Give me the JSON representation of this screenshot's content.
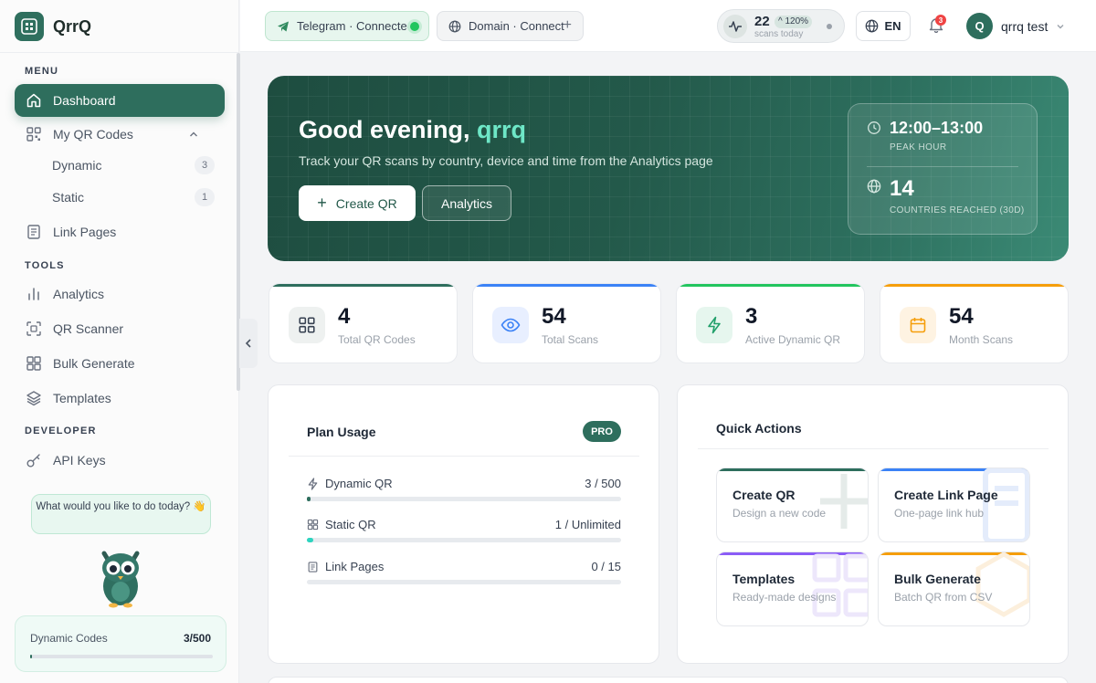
{
  "app": {
    "name": "QrrQ"
  },
  "sidebar": {
    "menu_label": "MENU",
    "tools_label": "TOOLS",
    "developer_label": "DEVELOPER",
    "items": {
      "dashboard": "Dashboard",
      "my_qr_codes": "My QR Codes",
      "dynamic": "Dynamic",
      "dynamic_count": "3",
      "static": "Static",
      "static_count": "1",
      "link_pages": "Link Pages",
      "analytics": "Analytics",
      "qr_scanner": "QR Scanner",
      "bulk_generate": "Bulk Generate",
      "templates": "Templates",
      "api_keys": "API Keys"
    },
    "assistant_prompt": "What would you like to do today? 👋",
    "dynamic_codes": {
      "label": "Dynamic Codes",
      "value": "3/500",
      "fraction": 0.006
    }
  },
  "topbar": {
    "telegram": "Telegram · Connected",
    "domain": "Domain · Connect",
    "scans_count": "22",
    "scans_change": "^ 120%",
    "scans_label": "scans today",
    "language": "EN",
    "notifications": "3",
    "avatar_initial": "Q",
    "username": "qrrq test"
  },
  "hero": {
    "greeting": "Good evening, ",
    "name": "qrrq",
    "subtitle": "Track your QR scans by country, device and time from the Analytics page",
    "create_button": "Create QR",
    "analytics_button": "Analytics",
    "peak_value": "12:00–13:00",
    "peak_label": "PEAK HOUR",
    "countries_value": "14",
    "countries_label": "COUNTRIES REACHED (30D)"
  },
  "stats": [
    {
      "value": "4",
      "label": "Total QR Codes",
      "color": "#2e6e5d"
    },
    {
      "value": "54",
      "label": "Total Scans",
      "color": "#3b82f6"
    },
    {
      "value": "3",
      "label": "Active Dynamic QR",
      "color": "#22c55e"
    },
    {
      "value": "54",
      "label": "Month Scans",
      "color": "#f59e0b"
    }
  ],
  "plan_usage": {
    "title": "Plan Usage",
    "badge": "PRO",
    "rows": [
      {
        "label": "Dynamic QR",
        "value": "3 / 500",
        "fraction": 0.006
      },
      {
        "label": "Static QR",
        "value": "1 / Unlimited",
        "fraction": 0.02
      },
      {
        "label": "Link Pages",
        "value": "0 / 15",
        "fraction": 0
      }
    ]
  },
  "quick_actions": {
    "title": "Quick Actions",
    "cards": [
      {
        "title": "Create QR",
        "subtitle": "Design a new code",
        "color": "#2e6e5d"
      },
      {
        "title": "Create Link Page",
        "subtitle": "One-page link hub",
        "color": "#3b82f6"
      },
      {
        "title": "Templates",
        "subtitle": "Ready-made designs",
        "color": "#8b5cf6"
      },
      {
        "title": "Bulk Generate",
        "subtitle": "Batch QR from CSV",
        "color": "#f59e0b"
      }
    ]
  }
}
